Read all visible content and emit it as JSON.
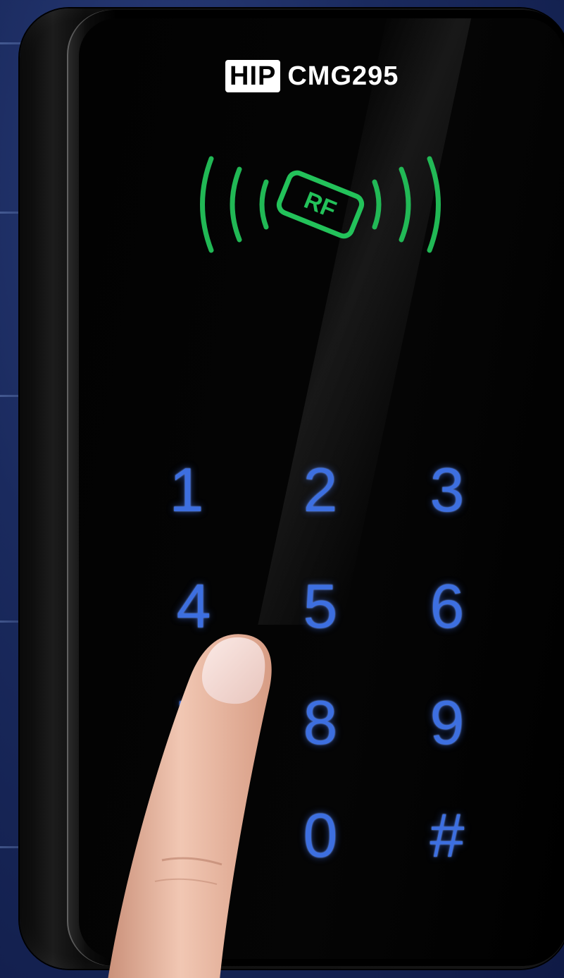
{
  "brand": {
    "logo_text": "HIP",
    "model": "CMG295"
  },
  "rf_reader": {
    "icon": "rf-card-icon",
    "label": "RF",
    "color": "#23c25a"
  },
  "keypad": {
    "color": "#3d6fe0",
    "keys": [
      "1",
      "2",
      "3",
      "4",
      "5",
      "6",
      "7",
      "8",
      "9",
      "0",
      "#"
    ]
  },
  "colors": {
    "background": "#1a2a5e",
    "device": "#000000"
  }
}
